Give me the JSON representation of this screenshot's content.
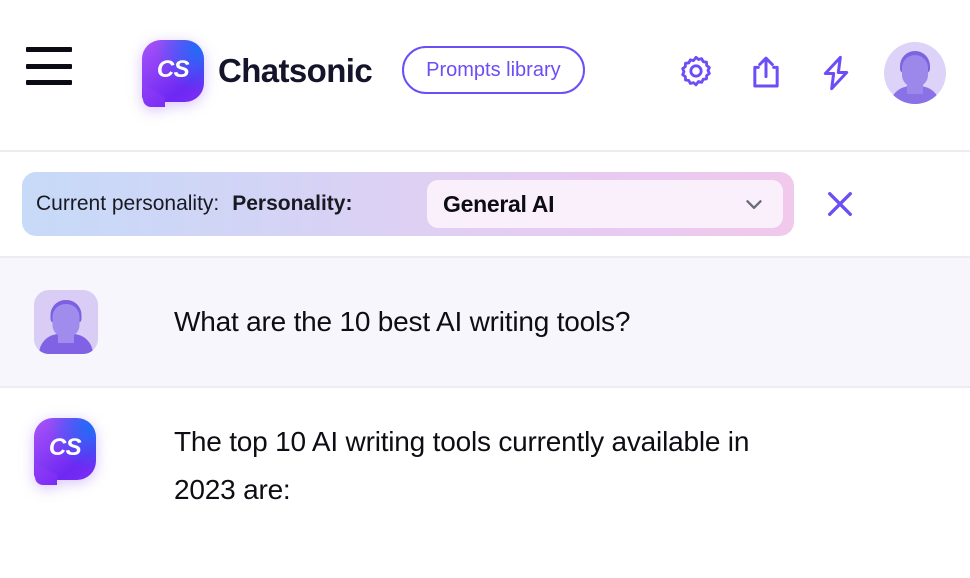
{
  "app": {
    "brand_name": "Chatsonic",
    "logo_text": "CS",
    "accent_color": "#6C4DF6",
    "brand_text_color": "#14142B"
  },
  "header": {
    "menu_icon": "hamburger-menu-icon",
    "logo_icon": "chatsonic-logo-icon",
    "prompts_library_label": "Prompts library",
    "actions": [
      {
        "name": "settings",
        "icon": "gear-icon"
      },
      {
        "name": "share",
        "icon": "share-upload-icon"
      },
      {
        "name": "quick-actions",
        "icon": "lightning-bolt-icon"
      },
      {
        "name": "account",
        "icon": "user-avatar-icon"
      }
    ]
  },
  "personality_bar": {
    "current_personality_label": "Current personality:",
    "personality_label": "Personality:",
    "selected_value": "General AI",
    "chevron_icon": "chevron-down-icon",
    "close_icon": "close-x-icon",
    "gradient_start": "#C7DAF8",
    "gradient_end": "#F0C9EC",
    "dropdown_bg": "#FAF0FB"
  },
  "conversation": {
    "messages": [
      {
        "role": "user",
        "avatar_icon": "user-avatar-icon",
        "text": "What are the 10 best AI writing tools?"
      },
      {
        "role": "assistant",
        "avatar_icon": "chatsonic-logo-icon",
        "text": "The top 10 AI writing tools currently available in 2023 are:"
      }
    ]
  }
}
